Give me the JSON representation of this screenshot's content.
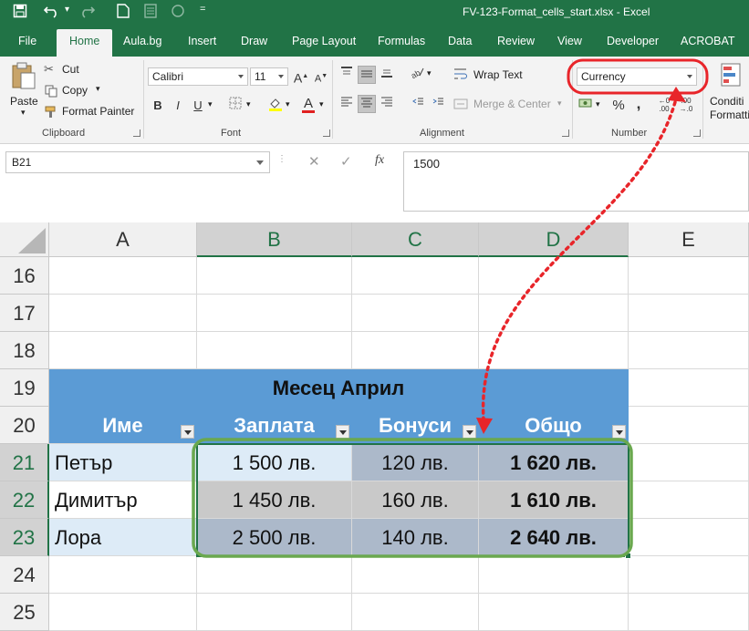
{
  "window": {
    "title": "FV-123-Format_cells_start.xlsx  -  Excel",
    "quick_access": [
      "save-icon",
      "undo-icon",
      "redo-icon",
      "new-icon",
      "form-icon",
      "circle-icon",
      "customize-icon"
    ]
  },
  "tabs": [
    "File",
    "Home",
    "Aula.bg",
    "Insert",
    "Draw",
    "Page Layout",
    "Formulas",
    "Data",
    "Review",
    "View",
    "Developer",
    "ACROBAT"
  ],
  "active_tab": "Home",
  "ribbon": {
    "clipboard": {
      "label": "Clipboard",
      "paste": "Paste",
      "cut": "Cut",
      "copy": "Copy",
      "format_painter": "Format Painter"
    },
    "font": {
      "label": "Font",
      "font_name": "Calibri",
      "font_size": "11",
      "bold": "B",
      "italic": "I",
      "underline": "U"
    },
    "alignment": {
      "label": "Alignment",
      "wrap_text": "Wrap Text",
      "merge_center": "Merge & Center"
    },
    "number": {
      "label": "Number",
      "format": "Currency",
      "percent": "%",
      "comma": ","
    },
    "styles": {
      "conditional_formatting": "Conditi Formatti"
    }
  },
  "formula_bar": {
    "name_box": "B21",
    "cancel": "✕",
    "enter": "✓",
    "fx": "fx",
    "value": "1500"
  },
  "sheet": {
    "columns": [
      "A",
      "B",
      "C",
      "D",
      "E"
    ],
    "selected_columns": [
      "B",
      "C",
      "D"
    ],
    "rows": [
      "16",
      "17",
      "18",
      "19",
      "20",
      "21",
      "22",
      "23",
      "24",
      "25"
    ],
    "selected_rows": [
      "21",
      "22",
      "23"
    ],
    "table_title": "Месец Април",
    "headers": [
      "Име",
      "Заплата",
      "Бонуси",
      "Общо"
    ],
    "data": [
      [
        "Петър",
        "1 500 лв.",
        "120 лв.",
        "1 620 лв."
      ],
      [
        "Димитър",
        "1 450 лв.",
        "160 лв.",
        "1 610 лв."
      ],
      [
        "Лора",
        "2 500 лв.",
        "140 лв.",
        "2 640 лв."
      ]
    ]
  },
  "colors": {
    "excel_green": "#217346",
    "header_blue": "#5b9bd5",
    "light_blue": "#ddebf7",
    "gray_blue": "#acb9ca",
    "annotation_red": "#e8252a",
    "annotation_green": "#6aa84f"
  }
}
